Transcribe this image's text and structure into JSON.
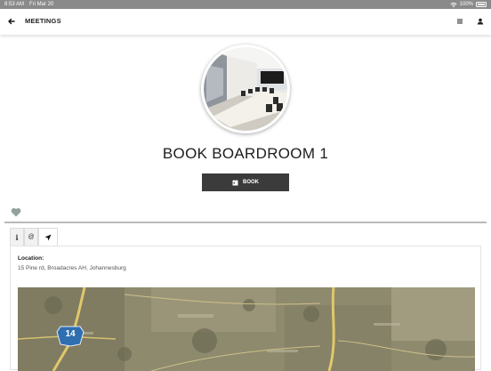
{
  "status_bar": {
    "time": "8:53 AM",
    "date": "Fri Mar 20",
    "battery": "100%"
  },
  "header": {
    "title": "MEETINGS"
  },
  "room": {
    "title": "BOOK BOARDROOM 1"
  },
  "actions": {
    "book_label": "BOOK"
  },
  "tabs": [
    {
      "icon": "info-icon",
      "glyph": "i"
    },
    {
      "icon": "at-icon",
      "glyph": "@"
    },
    {
      "icon": "navigation-arrow-icon",
      "glyph": ""
    }
  ],
  "details": {
    "location_label": "Location:",
    "location_value": "15 Pine rd, Broadacres AH, Johannesburg"
  },
  "map": {
    "route_marker": "14"
  },
  "colors": {
    "status_bar": "#8a8a8a",
    "button_dark": "#3b3b3b",
    "heart": "#8fa39a",
    "route_shield": "#2f6fb0"
  }
}
